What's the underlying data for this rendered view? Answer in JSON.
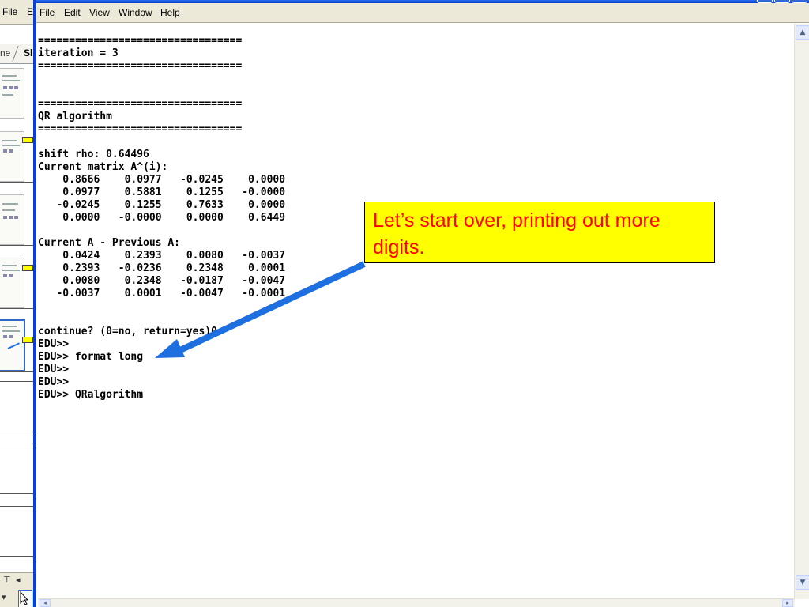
{
  "background_app": {
    "menu": [
      "File",
      "E"
    ],
    "tabs": [
      "ne",
      "Sl"
    ]
  },
  "window": {
    "menu": [
      "File",
      "Edit",
      "View",
      "Window",
      "Help"
    ]
  },
  "console": {
    "lines": [
      "=================================",
      "iteration = 3",
      "=================================",
      "",
      "",
      "=================================",
      "QR algorithm",
      "=================================",
      "",
      "shift rho: 0.64496",
      "Current matrix A^(i):",
      "    0.8666    0.0977   -0.0245    0.0000",
      "    0.0977    0.5881    0.1255   -0.0000",
      "   -0.0245    0.1255    0.7633    0.0000",
      "    0.0000   -0.0000    0.0000    0.6449",
      "",
      "Current A - Previous A:",
      "    0.0424    0.2393    0.0080   -0.0037",
      "    0.2393   -0.0236    0.2348    0.0001",
      "    0.0080    0.2348   -0.0187   -0.0047",
      "   -0.0037    0.0001   -0.0047   -0.0001",
      "",
      "",
      "continue? (0=no, return=yes)0",
      "EDU>>",
      "EDU>> format long",
      "EDU>>",
      "EDU>>",
      "EDU>> QRalgorithm"
    ]
  },
  "callout": {
    "text": "Let’s start over, printing out more digits."
  },
  "colors": {
    "callout_bg": "#ffff00",
    "callout_text": "#ff0000",
    "arrow": "#1e6fe0",
    "window_border": "#0a3fd1"
  },
  "icons": {
    "scroll_up": "triangle-up",
    "scroll_down": "triangle-down",
    "scroll_left": "triangle-left",
    "scroll_right": "triangle-right",
    "pointer": "cursor-arrow"
  }
}
